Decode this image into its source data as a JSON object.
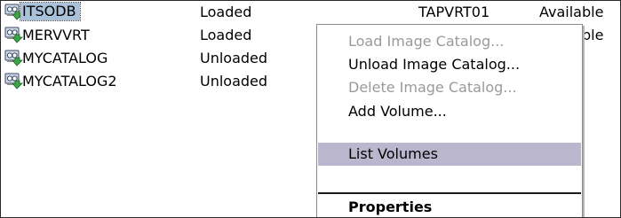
{
  "catalogs": [
    {
      "name": "ITSODB",
      "status": "Loaded",
      "drive": "TAPVRT01",
      "availability": "Available",
      "selected": true
    },
    {
      "name": "MERVVRT",
      "status": "Loaded",
      "drive": "",
      "availability": "Available",
      "selected": false
    },
    {
      "name": "MYCATALOG",
      "status": "Unloaded",
      "drive": "",
      "availability": "",
      "selected": false
    },
    {
      "name": "MYCATALOG2",
      "status": "Unloaded",
      "drive": "",
      "availability": "",
      "selected": false
    }
  ],
  "context_menu": {
    "items": [
      {
        "label": "Load Image Catalog...",
        "enabled": false,
        "highlighted": false
      },
      {
        "label": "Unload Image Catalog...",
        "enabled": true,
        "highlighted": false
      },
      {
        "label": "Delete Image Catalog...",
        "enabled": false,
        "highlighted": false
      },
      {
        "label": "Add Volume...",
        "enabled": true,
        "highlighted": false
      },
      {
        "label": "List Volumes",
        "enabled": true,
        "highlighted": true
      }
    ],
    "default_item": "Properties"
  },
  "colors": {
    "menu_highlight": "#bab6cd",
    "selection": "#a9c1d9",
    "disabled_text": "#9a9a9a"
  },
  "icons": {
    "catalog": "image-catalog-icon"
  }
}
